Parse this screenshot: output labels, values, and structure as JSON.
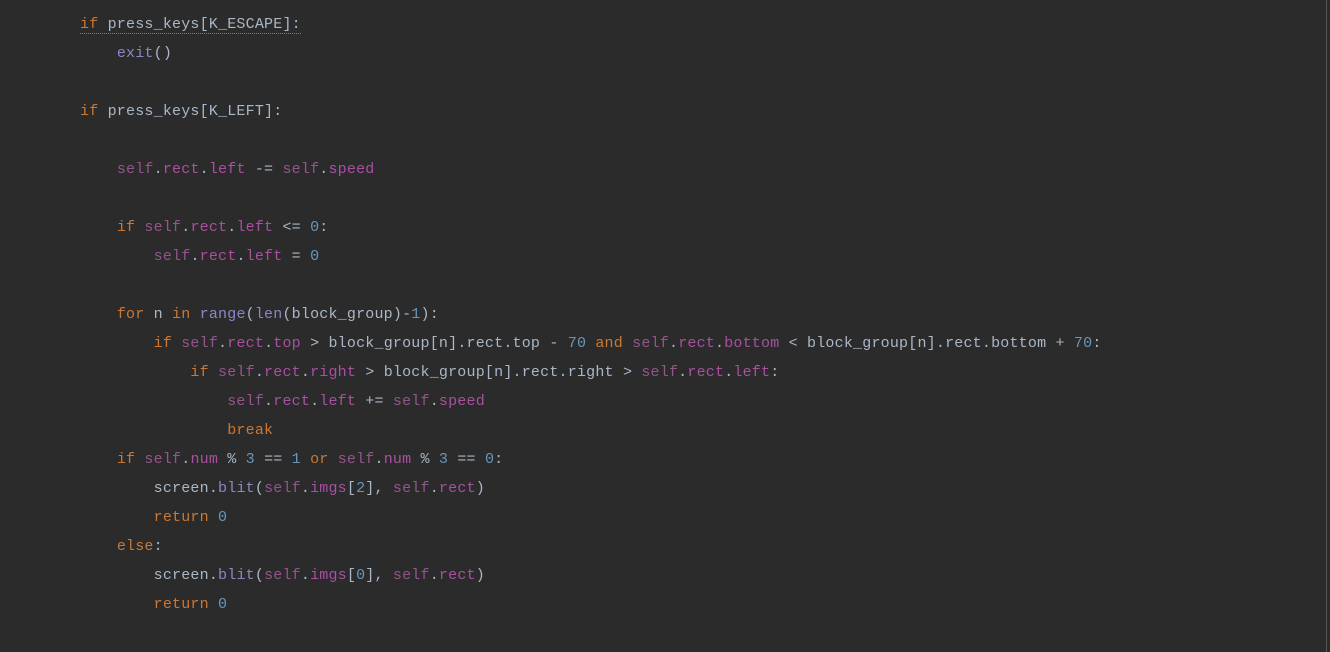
{
  "code": {
    "tokens": {
      "if": "if",
      "for": "for",
      "in": "in",
      "and": "and",
      "or": "or",
      "else": "else",
      "return": "return",
      "break": "break",
      "self": "self",
      "press_keys": "press_keys",
      "K_ESCAPE": "K_ESCAPE",
      "K_LEFT": "K_LEFT",
      "exit": "exit",
      "rect": "rect",
      "left": "left",
      "right": "right",
      "top": "top",
      "bottom": "bottom",
      "speed": "speed",
      "range": "range",
      "len": "len",
      "block_group": "block_group",
      "n": "n",
      "num": "num",
      "screen": "screen",
      "blit": "blit",
      "imgs": "imgs"
    },
    "nums": {
      "zero": "0",
      "one": "1",
      "two": "2",
      "three": "3",
      "seventy": "70"
    },
    "ops": {
      "open_bracket": "[",
      "close_bracket": "]",
      "colon": ":",
      "open_paren": "(",
      "close_paren": ")",
      "dot": ".",
      "minus_eq": "-=",
      "plus_eq": "+=",
      "le": "<=",
      "lt": "<",
      "gt": ">",
      "eq": "=",
      "eqeq": "==",
      "minus": "-",
      "plus": "+",
      "mod": "%",
      "comma": ","
    }
  }
}
